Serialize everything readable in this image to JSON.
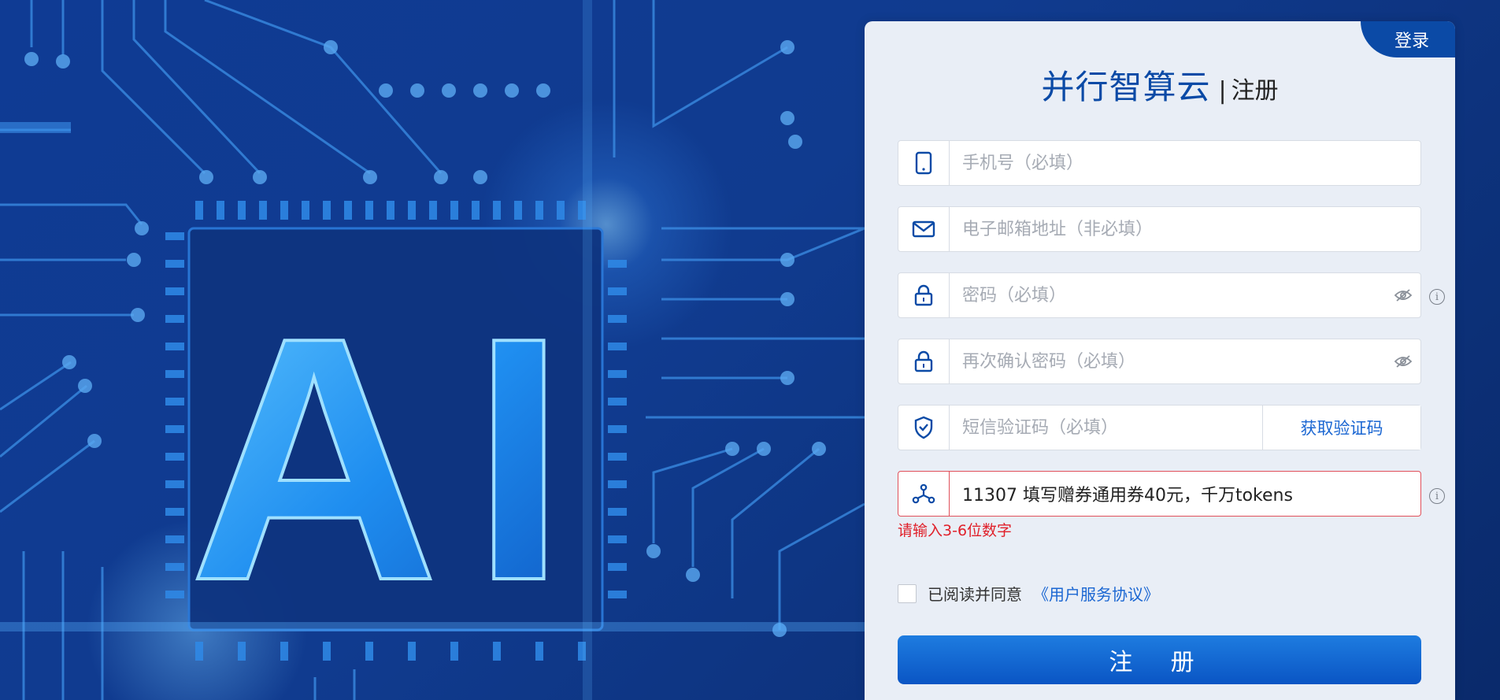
{
  "header": {
    "login_tab": "登录",
    "brand": "并行智算云",
    "separator": "|",
    "subtitle": "注册"
  },
  "form": {
    "phone": {
      "placeholder": "手机号（必填）",
      "value": ""
    },
    "email": {
      "placeholder": "电子邮箱地址（非必填）",
      "value": ""
    },
    "password": {
      "placeholder": "密码（必填）",
      "value": ""
    },
    "confirm_password": {
      "placeholder": "再次确认密码（必填）",
      "value": ""
    },
    "sms_code": {
      "placeholder": "短信验证码（必填）",
      "value": "",
      "button": "获取验证码"
    },
    "invite_code": {
      "value": "11307 填写赠券通用券40元，千万tokens",
      "error": "请输入3-6位数字"
    },
    "agree_text": "已阅读并同意",
    "agree_link": "《用户服务协议》",
    "submit": "注 册"
  },
  "background": {
    "hero_text": "AI"
  },
  "colors": {
    "brand": "#0b4aa6",
    "link": "#1a66d2",
    "error": "#e0202a"
  }
}
